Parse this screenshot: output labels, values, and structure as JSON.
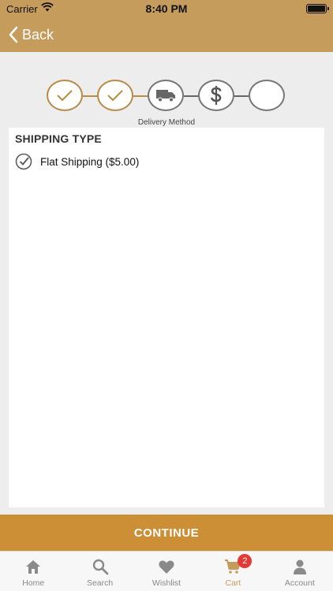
{
  "status_bar": {
    "carrier": "Carrier",
    "time": "8:40 PM"
  },
  "header": {
    "back_label": "Back"
  },
  "colors": {
    "brand": "#c69c5d",
    "accent": "#cc8f35",
    "step_done": "#b98b4a",
    "badge": "#e53935"
  },
  "stepper": {
    "steps": [
      {
        "icon": "check-icon",
        "state": "done"
      },
      {
        "icon": "check-icon",
        "state": "done"
      },
      {
        "icon": "truck-icon",
        "state": "current"
      },
      {
        "icon": "dollar-icon",
        "state": "pending"
      },
      {
        "icon": "empty",
        "state": "pending"
      }
    ],
    "caption": "Delivery Method"
  },
  "shipping": {
    "title": "SHIPPING TYPE",
    "options": [
      {
        "label": "Flat Shipping ($5.00)",
        "selected": true
      }
    ]
  },
  "continue_label": "CONTINUE",
  "tabbar": {
    "items": [
      {
        "label": "Home",
        "icon": "home-icon"
      },
      {
        "label": "Search",
        "icon": "search-icon"
      },
      {
        "label": "Wishlist",
        "icon": "heart-icon"
      },
      {
        "label": "Cart",
        "icon": "cart-icon",
        "badge": "2",
        "active": true
      },
      {
        "label": "Account",
        "icon": "account-icon"
      }
    ]
  }
}
